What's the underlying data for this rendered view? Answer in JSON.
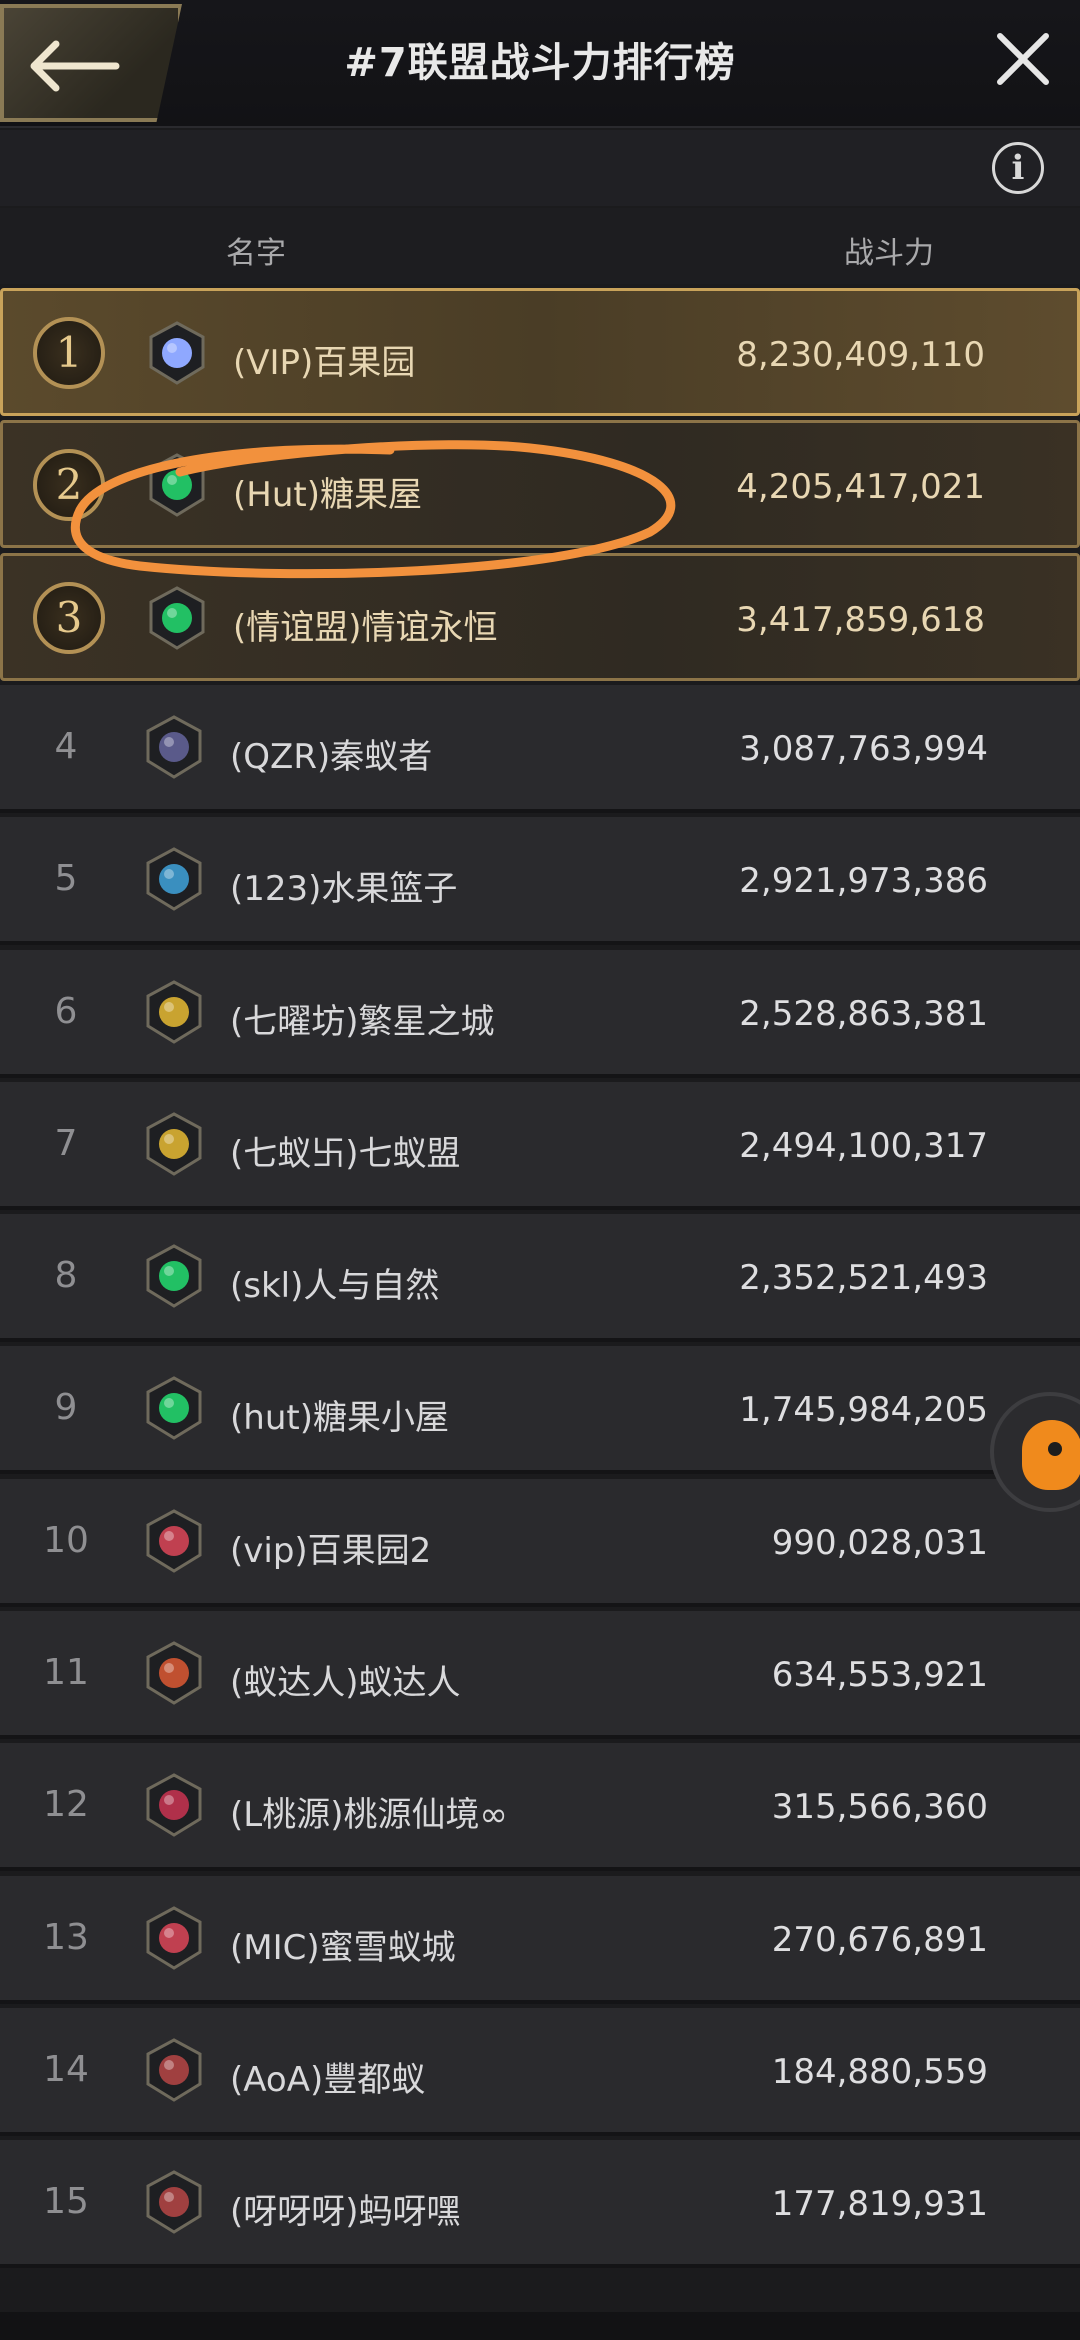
{
  "header": {
    "title": "#7联盟战斗力排行榜"
  },
  "columns": {
    "name": "名字",
    "power": "战斗力"
  },
  "info_label": "i",
  "rows": [
    {
      "rank": "1",
      "name": "(VIP)百果园",
      "power": "8,230,409,110",
      "emblem": "diamond-crest-icon",
      "color": "#8fa8ff"
    },
    {
      "rank": "2",
      "name": "(Hut)糖果屋",
      "power": "4,205,417,021",
      "emblem": "clover-crest-icon",
      "color": "#22c064"
    },
    {
      "rank": "3",
      "name": "(情谊盟)情谊永恒",
      "power": "3,417,859,618",
      "emblem": "clover-crest-icon",
      "color": "#22c064"
    },
    {
      "rank": "4",
      "name": "(QZR)秦蚁者",
      "power": "3,087,763,994",
      "emblem": "dark-shard-crest-icon",
      "color": "#5a5a8a"
    },
    {
      "rank": "5",
      "name": "(123)水果篮子",
      "power": "2,921,973,386",
      "emblem": "blue-rider-crest-icon",
      "color": "#3a8fbf"
    },
    {
      "rank": "6",
      "name": "(七曜坊)繁星之城",
      "power": "2,528,863,381",
      "emblem": "gold-orb-crest-icon",
      "color": "#c9a330"
    },
    {
      "rank": "7",
      "name": "(七蚁卐)七蚁盟",
      "power": "2,494,100,317",
      "emblem": "gold-orb-crest-icon",
      "color": "#c9a330"
    },
    {
      "rank": "8",
      "name": "(skl)人与自然",
      "power": "2,352,521,493",
      "emblem": "clover-crest-icon",
      "color": "#22c064"
    },
    {
      "rank": "9",
      "name": "(hut)糖果小屋",
      "power": "1,745,984,205",
      "emblem": "clover-crest-icon",
      "color": "#22c064"
    },
    {
      "rank": "10",
      "name": "(vip)百果园2",
      "power": "990,028,031",
      "emblem": "knight-crest-icon",
      "color": "#c04050"
    },
    {
      "rank": "11",
      "name": "(蚁达人)蚁达人",
      "power": "634,553,921",
      "emblem": "red-v-crest-icon",
      "color": "#c05030"
    },
    {
      "rank": "12",
      "name": "(L桃源)桃源仙境∞",
      "power": "315,566,360",
      "emblem": "red-spiral-crest-icon",
      "color": "#b0304a"
    },
    {
      "rank": "13",
      "name": "(MIC)蜜雪蚁城",
      "power": "270,676,891",
      "emblem": "knight-crest-icon",
      "color": "#c04050"
    },
    {
      "rank": "14",
      "name": "(AoA)豐都蚁",
      "power": "184,880,559",
      "emblem": "red-shield-crest-icon",
      "color": "#a04040"
    },
    {
      "rank": "15",
      "name": "(呀呀呀)蚂呀嘿",
      "power": "177,819,931",
      "emblem": "red-shield-crest-icon",
      "color": "#a04040"
    }
  ]
}
